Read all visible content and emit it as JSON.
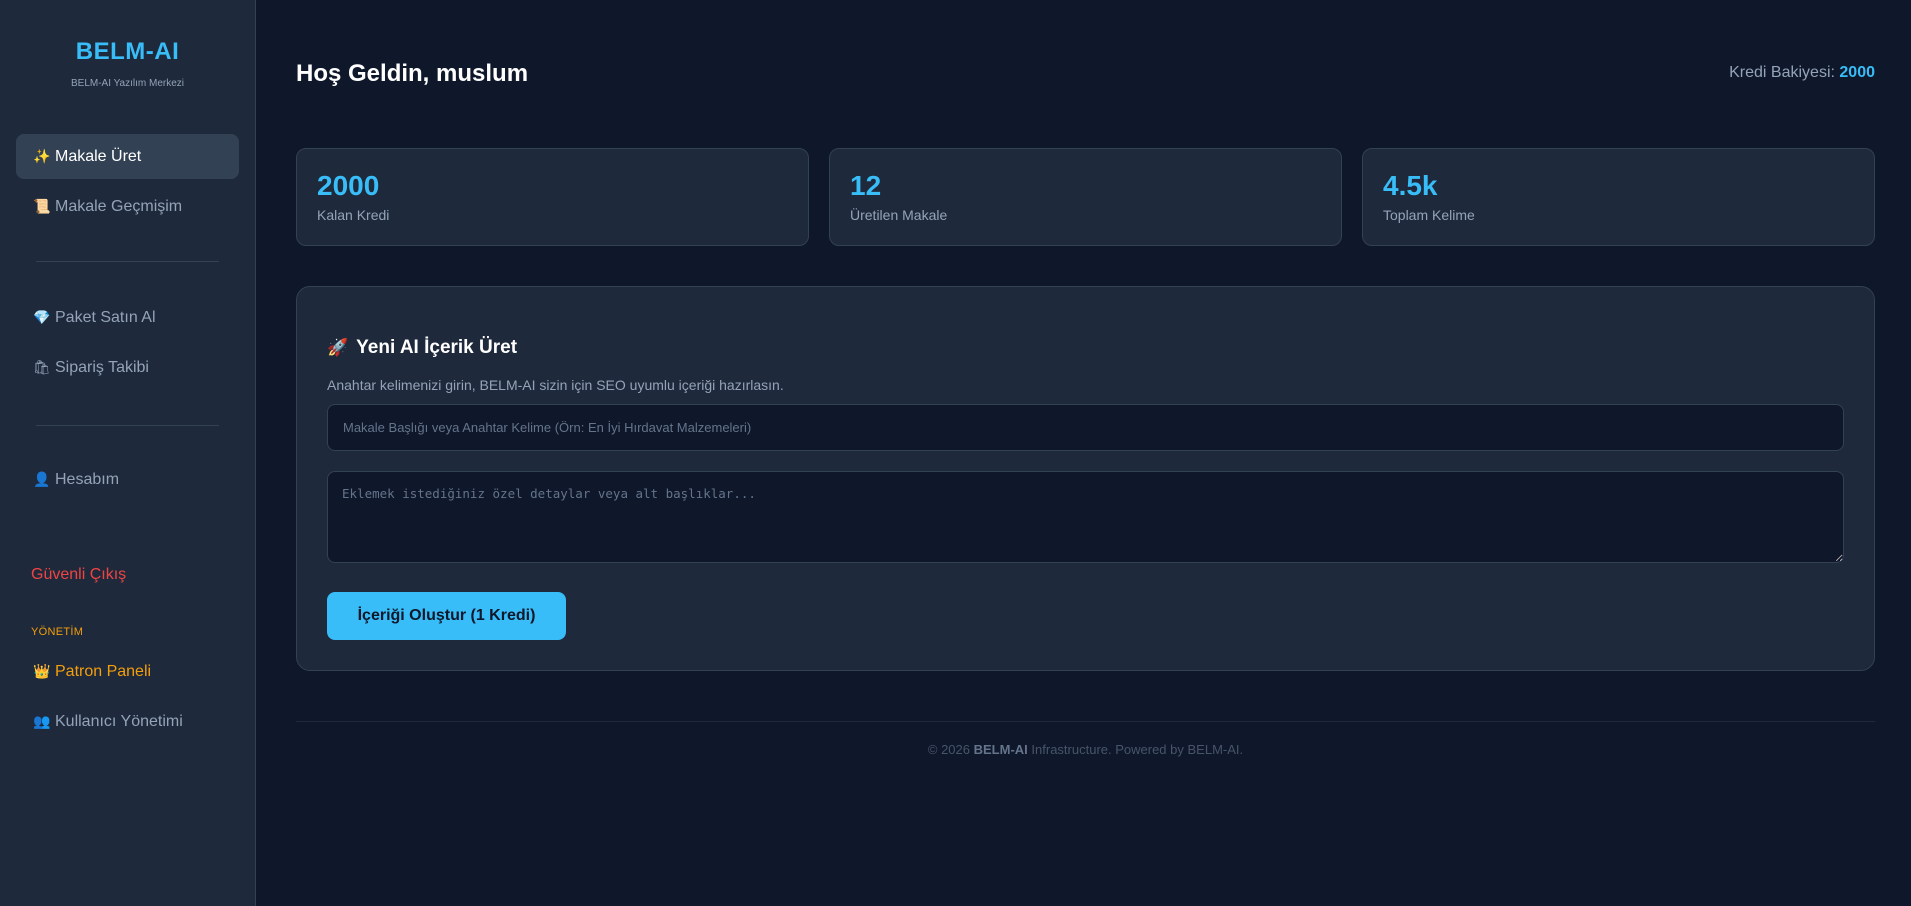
{
  "sidebar": {
    "brand": "BELM-AI",
    "subtitle": "BELM-AI Yazılım Merkezi",
    "items": [
      {
        "icon": "✨",
        "label": "Makale Üret"
      },
      {
        "icon": "📜",
        "label": "Makale Geçmişim"
      },
      {
        "icon": "💎",
        "label": "Paket Satın Al"
      },
      {
        "icon": "🛍",
        "label": "Sipariş Takibi"
      },
      {
        "icon": "👤",
        "label": "Hesabım"
      }
    ],
    "logout": "Güvenli Çıkış",
    "admin_label": "YÖNETİM",
    "admin_items": [
      {
        "icon": "👑",
        "label": "Patron Paneli"
      },
      {
        "icon": "👥",
        "label": "Kullanıcı Yönetimi"
      }
    ]
  },
  "header": {
    "welcome": "Hoş Geldin, muslum",
    "credit_label": "Kredi Bakiyesi:",
    "credit_value": "2000"
  },
  "stats": [
    {
      "value": "2000",
      "label": "Kalan Kredi"
    },
    {
      "value": "12",
      "label": "Üretilen Makale"
    },
    {
      "value": "4.5k",
      "label": "Toplam Kelime"
    }
  ],
  "generator": {
    "icon": "🚀",
    "title": "Yeni AI İçerik Üret",
    "description": "Anahtar kelimenizi girin, BELM-AI sizin için SEO uyumlu içeriği hazırlasın.",
    "title_placeholder": "Makale Başlığı veya Anahtar Kelime (Örn: En İyi Hırdavat Malzemeleri)",
    "title_value": "",
    "details_placeholder": "Eklemek istediğiniz özel detaylar veya alt başlıklar...",
    "details_value": "",
    "button": "İçeriği Oluştur (1 Kredi)"
  },
  "footer": {
    "prefix": "© 2026",
    "brand": "BELM-AI",
    "suffix": "Infrastructure. Powered by BELM-AI."
  },
  "colors": {
    "background": "#0f172a",
    "surface": "#1e293b",
    "accent": "#38bdf8",
    "danger": "#ef4444",
    "admin": "#f59e0b"
  }
}
